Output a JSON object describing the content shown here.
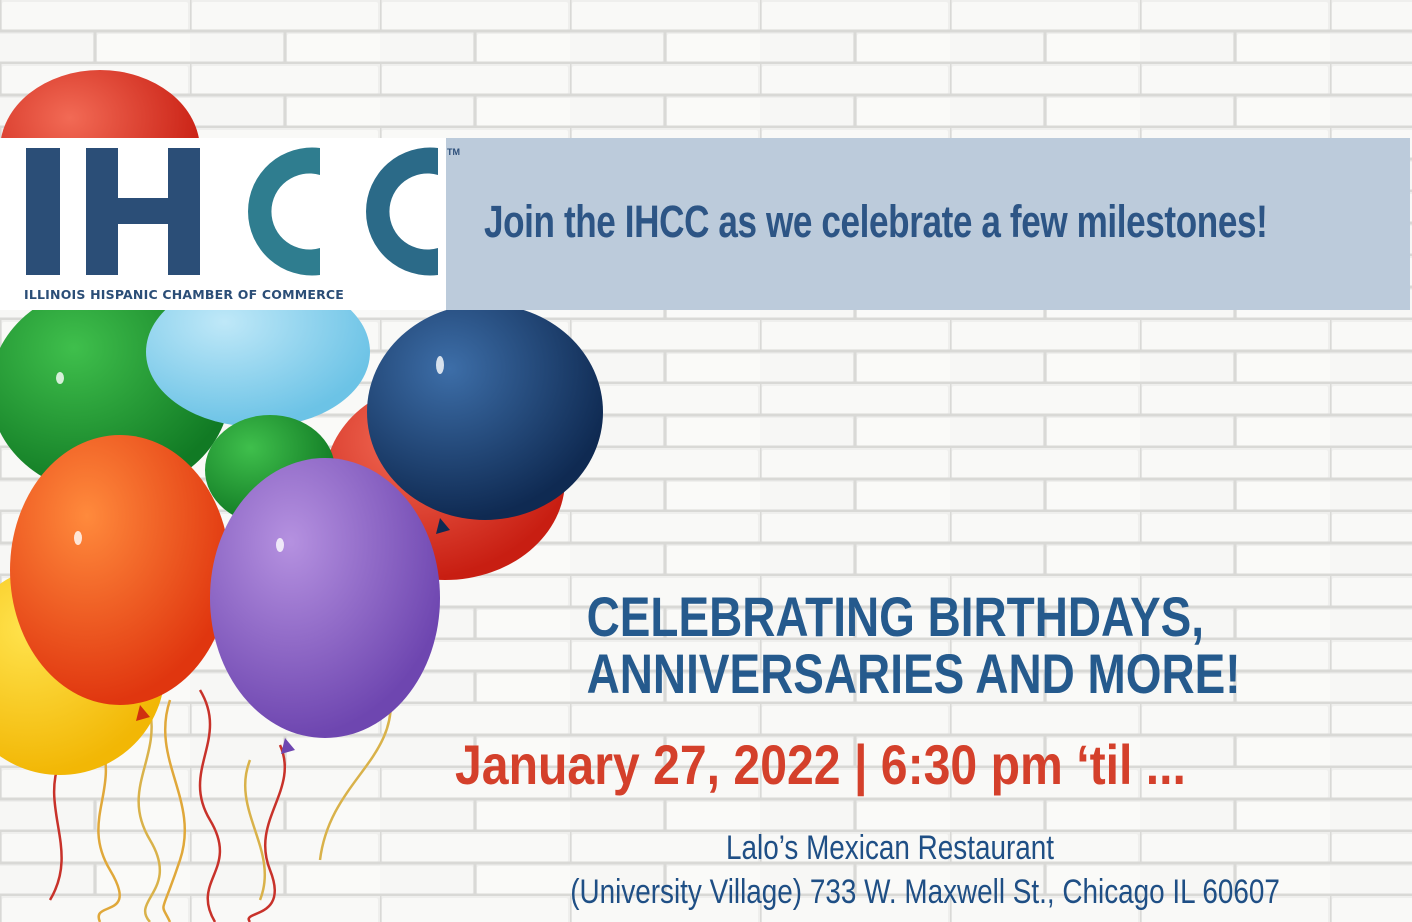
{
  "logo": {
    "letters": "IHCC",
    "trademark": "TM",
    "subtitle": "ILLINOIS HISPANIC CHAMBER OF COMMERCE"
  },
  "banner": {
    "headline": "Join the IHCC as we celebrate a few milestones!"
  },
  "event": {
    "title_line1": "CELEBRATING BIRTHDAYS,",
    "title_line2": "ANNIVERSARIES AND MORE!",
    "date_time": "January 27, 2022 | 6:30 pm ‘til ...",
    "venue_name": "Lalo’s Mexican Restaurant",
    "venue_address": "(University Village) 733 W. Maxwell St., Chicago IL 60607"
  },
  "colors": {
    "logo_dark_blue": "#2b4e77",
    "logo_teal": "#2f7d8f",
    "banner_bg": "#bccbdb",
    "headline_blue": "#2d5585",
    "title_blue": "#255a8d",
    "date_red": "#d4402b",
    "wall_white": "#efefed"
  },
  "decoration": {
    "background": "white brick wall",
    "balloon_colors": [
      "red",
      "green",
      "light blue",
      "navy blue",
      "orange",
      "purple",
      "yellow"
    ]
  }
}
